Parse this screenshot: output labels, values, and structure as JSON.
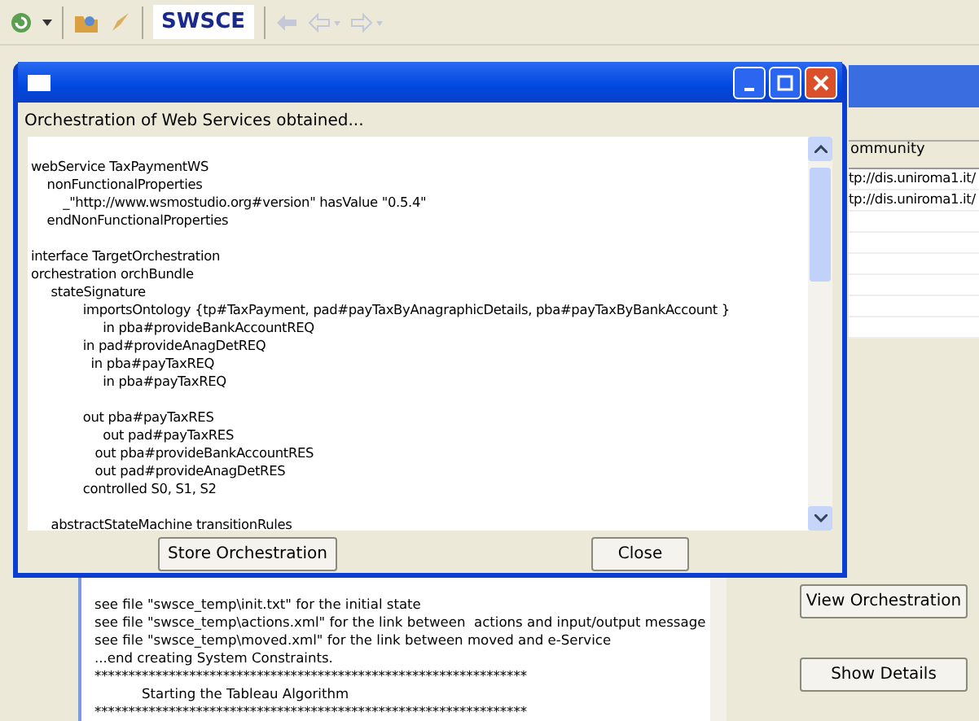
{
  "toolbar": {
    "brand": "SWSCE",
    "nav_disabled": true
  },
  "table": {
    "columns": [
      "ommunity"
    ],
    "rows": [
      [
        "tp://dis.uniroma1.it/"
      ],
      [
        "tp://dis.uniroma1.it/"
      ]
    ]
  },
  "log": {
    "lines": [
      "see file \"swsce_temp\\init.txt\" for the initial state",
      "see file \"swsce_temp\\actions.xml\" for the link between  actions and input/output message",
      "see file \"swsce_temp\\moved.xml\" for the link between moved and e-Service",
      "...end creating System Constraints.",
      "****************************************************************",
      "           Starting the Tableau Algorithm",
      "****************************************************************"
    ]
  },
  "side_buttons": [
    "View Orchestration",
    "Show Details"
  ],
  "dialog": {
    "message": "Orchestration of Web Services obtained...",
    "code_blocks": [
      [
        "webService TaxPaymentWS",
        "    nonFunctionalProperties",
        "        _\"http://www.wsmostudio.org#version\" hasValue \"0.5.4\"",
        "    endNonFunctionalProperties"
      ],
      [
        "interface TargetOrchestration",
        "orchestration orchBundle",
        "     stateSignature",
        "             importsOntology {tp#TaxPayment, pad#payTaxByAnagraphicDetails, pba#payTaxByBankAccount }",
        "                  in pba#provideBankAccountREQ",
        "             in pad#provideAnagDetREQ",
        "               in pba#payTaxREQ",
        "                  in pba#payTaxREQ"
      ],
      [
        "             out pba#payTaxRES",
        "                  out pad#payTaxRES",
        "                out pba#provideBankAccountRES",
        "                out pad#provideAnagDetRES",
        "             controlled S0, S1, S2"
      ],
      [
        "     abstractStateMachine transitionRules"
      ]
    ],
    "buttons": [
      "Store Orchestration",
      "Close"
    ]
  }
}
